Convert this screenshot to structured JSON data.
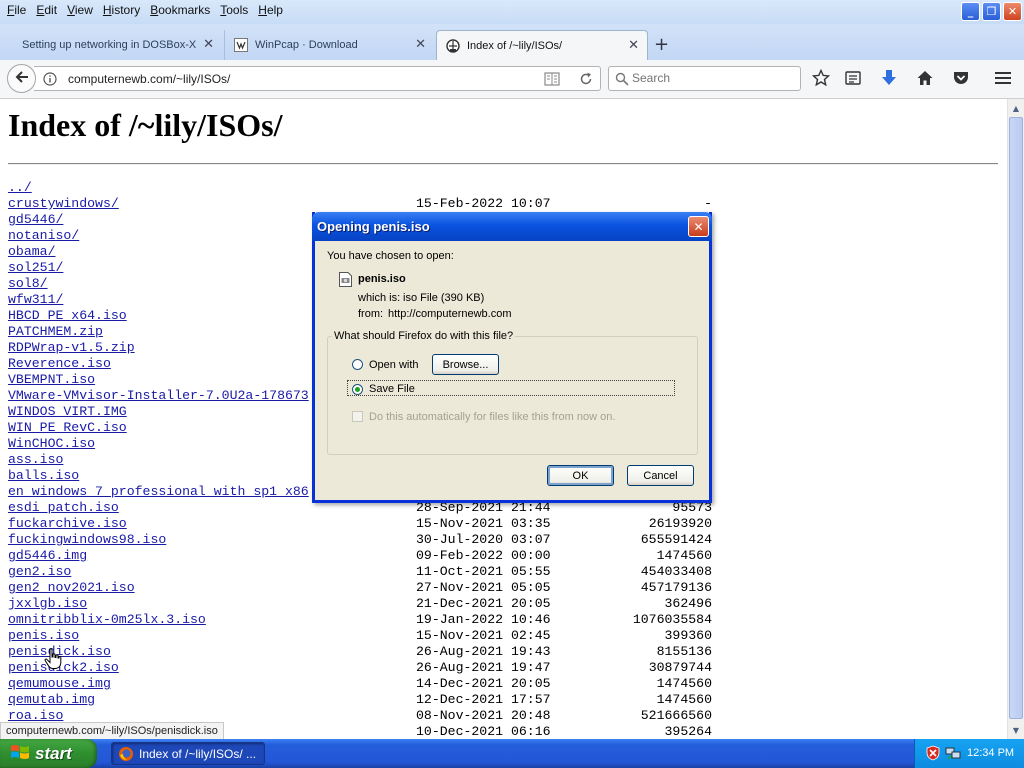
{
  "menu": [
    "File",
    "Edit",
    "View",
    "History",
    "Bookmarks",
    "Tools",
    "Help"
  ],
  "tabs": [
    {
      "title": "Setting up networking in DOSBox-X",
      "active": false
    },
    {
      "title": "WinPcap · Download",
      "active": false
    },
    {
      "title": "Index of /~lily/ISOs/",
      "active": true
    }
  ],
  "address": {
    "url": "computernewb.com/~lily/ISOs/"
  },
  "search": {
    "placeholder": "Search"
  },
  "page": {
    "heading": "Index of /~lily/ISOs/",
    "files": [
      {
        "name": "../",
        "date": "",
        "size": ""
      },
      {
        "name": "crustywindows/",
        "date": "15-Feb-2022 10:07",
        "size": "-"
      },
      {
        "name": "gd5446/",
        "date": "",
        "size": ""
      },
      {
        "name": "notaniso/",
        "date": "",
        "size": ""
      },
      {
        "name": "obama/",
        "date": "",
        "size": ""
      },
      {
        "name": "sol251/",
        "date": "",
        "size": ""
      },
      {
        "name": "sol8/",
        "date": "",
        "size": ""
      },
      {
        "name": "wfw311/",
        "date": "",
        "size": ""
      },
      {
        "name": "HBCD_PE_x64.iso",
        "date": "",
        "size": ""
      },
      {
        "name": "PATCHMEM.zip",
        "date": "",
        "size": ""
      },
      {
        "name": "RDPWrap-v1.5.zip",
        "date": "",
        "size": ""
      },
      {
        "name": "Reverence.iso",
        "date": "",
        "size": ""
      },
      {
        "name": "VBEMPNT.iso",
        "date": "",
        "size": ""
      },
      {
        "name": "VMware-VMvisor-Installer-7.0U2a-178673",
        "date": "",
        "size": ""
      },
      {
        "name": "WINDOS_VIRT.IMG",
        "date": "",
        "size": ""
      },
      {
        "name": "WIN_PE_RevC.iso",
        "date": "",
        "size": ""
      },
      {
        "name": "WinCHOC.iso",
        "date": "",
        "size": ""
      },
      {
        "name": "ass.iso",
        "date": "",
        "size": ""
      },
      {
        "name": "balls.iso",
        "date": "",
        "size": ""
      },
      {
        "name": "en_windows_7_professional_with_sp1_x86",
        "date": "",
        "size": ""
      },
      {
        "name": "esdi_patch.iso",
        "date": "28-Sep-2021 21:44",
        "size": "95573"
      },
      {
        "name": "fuckarchive.iso",
        "date": "15-Nov-2021 03:35",
        "size": "26193920"
      },
      {
        "name": "fuckingwindows98.iso",
        "date": "30-Jul-2020 03:07",
        "size": "655591424"
      },
      {
        "name": "gd5446.img",
        "date": "09-Feb-2022 00:00",
        "size": "1474560"
      },
      {
        "name": "gen2.iso",
        "date": "11-Oct-2021 05:55",
        "size": "454033408"
      },
      {
        "name": "gen2_nov2021.iso",
        "date": "27-Nov-2021 05:05",
        "size": "457179136"
      },
      {
        "name": "jxxlgb.iso",
        "date": "21-Dec-2021 20:05",
        "size": "362496"
      },
      {
        "name": "omnitribblix-0m25lx.3.iso",
        "date": "19-Jan-2022 10:46",
        "size": "1076035584"
      },
      {
        "name": "penis.iso",
        "date": "15-Nov-2021 02:45",
        "size": "399360"
      },
      {
        "name": "penisdick.iso",
        "date": "26-Aug-2021 19:43",
        "size": "8155136"
      },
      {
        "name": "penisdick2.iso",
        "date": "26-Aug-2021 19:47",
        "size": "30879744"
      },
      {
        "name": "qemumouse.img",
        "date": "14-Dec-2021 20:05",
        "size": "1474560"
      },
      {
        "name": "qemutab.img",
        "date": "12-Dec-2021 17:57",
        "size": "1474560"
      },
      {
        "name": "roa.iso",
        "date": "08-Nov-2021 20:48",
        "size": "521666560"
      },
      {
        "name": "",
        "date": "10-Dec-2021 06:16",
        "size": "395264"
      }
    ]
  },
  "status_link": "computernewb.com/~lily/ISOs/penisdick.iso",
  "dialog": {
    "title": "Opening penis.iso",
    "chosen_label": "You have chosen to open:",
    "file_name": "penis.iso",
    "which_is_label": "which is:",
    "which_is_value": "iso File (390 KB)",
    "from_label": "from:",
    "from_value": "http://computernewb.com",
    "question": "What should Firefox do with this file?",
    "open_with_label": "Open with",
    "browse_label": "Browse...",
    "save_file_label": "Save File",
    "selected_option": "Save File",
    "auto_label": "Do this automatically for files like this from now on.",
    "auto_checked": false,
    "ok_label": "OK",
    "cancel_label": "Cancel"
  },
  "taskbar": {
    "start_label": "start",
    "task_label": "Index of /~lily/ISOs/ ...",
    "clock": "12:34 PM"
  },
  "colors": {
    "link": "#1a1aa6",
    "xp_blue": "#0a53e1",
    "start_green": "#2f8f2f",
    "taskbar": "#245edb"
  }
}
